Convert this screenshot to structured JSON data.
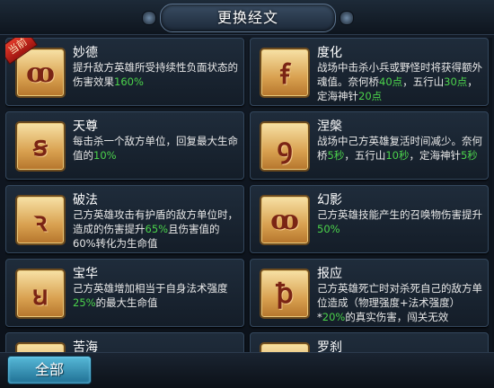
{
  "title": "更换经文",
  "current_badge": "当前",
  "bottom": {
    "all_button": "全部"
  },
  "cards": [
    {
      "name": "妙德",
      "glyph": "ꝏ",
      "desc_parts": [
        "提升敌方英雄所受持续性负面状态的伤害效果",
        "160%",
        ""
      ],
      "current": true
    },
    {
      "name": "度化",
      "glyph": "ꞙ",
      "desc_parts": [
        "战场中击杀小兵或野怪时将获得额外魂值。奈何桥",
        "40点",
        "，五行山",
        "30点",
        "，定海神针",
        "20点"
      ]
    },
    {
      "name": "天尊",
      "glyph": "ꞩ",
      "desc_parts": [
        "每击杀一个敌方单位，回复最大生命值的",
        "10%",
        ""
      ]
    },
    {
      "name": "涅槃",
      "glyph": "ꝯ",
      "desc_parts": [
        "战场中己方英雄复活时间减少。奈何桥",
        "5秒",
        "，五行山",
        "10秒",
        "，定海神针",
        "5秒"
      ]
    },
    {
      "name": "破法",
      "glyph": "ꝛ",
      "desc_parts": [
        "己方英雄攻击有护盾的敌方单位时，造成的伤害提升",
        "65%",
        "且伤害值的60%转化为生命值"
      ]
    },
    {
      "name": "幻影",
      "glyph": "ꝏ",
      "desc_parts": [
        "己方英雄技能产生的召唤物伤害提升",
        "50%",
        ""
      ]
    },
    {
      "name": "宝华",
      "glyph": "ꞟ",
      "desc_parts": [
        "己方英雄增加相当于自身法术强度",
        "25%",
        "的最大生命值"
      ]
    },
    {
      "name": "报应",
      "glyph": "ꝥ",
      "desc_parts": [
        "己方英雄死亡时对杀死自己的敌方单位造成（物理强度+法术强度）*",
        "20%",
        "的真实伤害，闯关无效"
      ]
    },
    {
      "name": "苦海",
      "glyph": "",
      "desc_parts": [
        "",
        "",
        ""
      ]
    },
    {
      "name": "罗刹",
      "glyph": "",
      "desc_parts": [
        "",
        "",
        ""
      ]
    }
  ]
}
